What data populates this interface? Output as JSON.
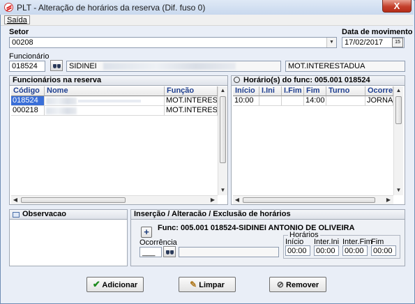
{
  "window": {
    "title": "PLT - Alteração de horários da reserva (Dif. fuso 0)",
    "close_label": "X"
  },
  "menu": {
    "saida": "Saída"
  },
  "setor": {
    "label": "Setor",
    "value": "00208"
  },
  "data_movimento": {
    "label": "Data de movimento",
    "value": "17/02/2017",
    "button_label": "15"
  },
  "funcionario": {
    "label": "Funcionário",
    "code": "018524",
    "name": "SIDINEI",
    "role": "MOT.INTERESTADUA"
  },
  "funcionarios_panel": {
    "title": "Funcionários na reserva",
    "columns": [
      "Código",
      "Nome",
      "Função"
    ],
    "rows": [
      {
        "codigo": "018524",
        "funcao": "MOT.INTEREST."
      },
      {
        "codigo": "000218",
        "funcao": "MOT.INTEREST."
      }
    ]
  },
  "horarios_panel": {
    "title": "Horário(s) do func: 005.001  018524",
    "columns": [
      "Início",
      "I.Ini",
      "I.Fim",
      "Fim",
      "Turno",
      "Ocorrer"
    ],
    "rows": [
      {
        "inicio": "10:00",
        "ini": "",
        "fim_int": "",
        "fim": "14:00",
        "turno": "",
        "ocorr": "JORNAC"
      }
    ]
  },
  "observacao": {
    "title": "Observacao"
  },
  "insercao": {
    "title": "Inserção / Alteracão / Exclusão de horários",
    "func_info": "Func: 005.001  018524-SIDINEI ANTONIO DE OLIVEIRA",
    "add_label": "+",
    "ocorrencia_label": "Ocorrência",
    "ocorrencia_value": "___",
    "horarios_label": "Horários",
    "fields": [
      {
        "label": "Início",
        "value": "00:00"
      },
      {
        "label": "Inter.Ini",
        "value": "00:00"
      },
      {
        "label": "Inter.Fim",
        "value": "00:00"
      },
      {
        "label": "Fim",
        "value": "00:00"
      }
    ]
  },
  "buttons": {
    "adicionar": "Adicionar",
    "limpar": "Limpar",
    "remover": "Remover"
  },
  "colors": {
    "title_bar": "#dfe9f6",
    "selection": "#3a6fd8",
    "column_header_text": "#1f3f8f",
    "close_button": "#c4402c"
  }
}
